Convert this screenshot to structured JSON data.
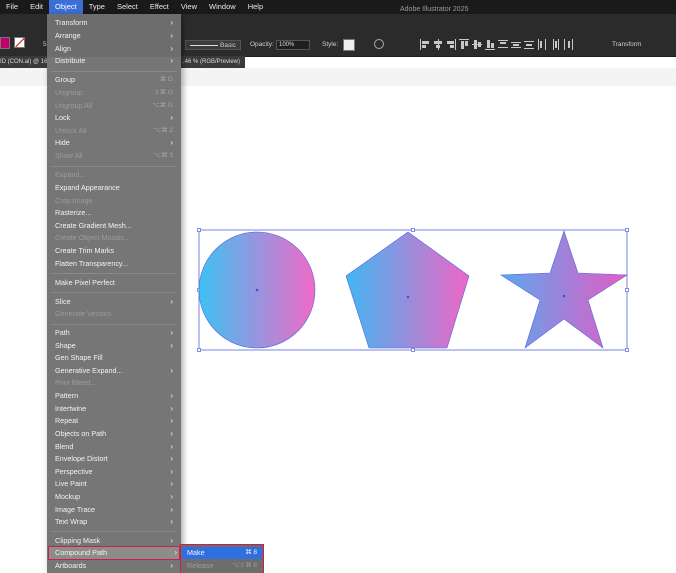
{
  "menubar": {
    "items": [
      "File",
      "Edit",
      "Object",
      "Type",
      "Select",
      "Effect",
      "View",
      "Window",
      "Help"
    ],
    "active": "Object"
  },
  "app_title": "Adobe Illustrator 2025",
  "controlbar": {
    "stroke_preset": "Basic",
    "opacity_label": "Opacity:",
    "opacity_value": "100%",
    "style_label": "Style:",
    "transform_label": "Transform",
    "stroke_weight_fragment": "5"
  },
  "document_tab": {
    "left_fragment": "ID (CON.ai) @ 16",
    "right_fragment": ".46 % (RGB/Preview)"
  },
  "object_menu": {
    "transform": "Transform",
    "arrange": "Arrange",
    "align": "Align",
    "distribute": "Distribute",
    "group": "Group",
    "group_sc": "⌘ G",
    "ungroup": "Ungroup",
    "ungroup_sc": "⇧⌘ G",
    "ungroup_all": "Ungroup All",
    "ungroup_all_sc": "⌥⌘ G",
    "lock": "Lock",
    "unlock_all": "Unlock All",
    "unlock_all_sc": "⌥⌘ 2",
    "hide": "Hide",
    "show_all": "Show All",
    "show_all_sc": "⌥⌘ 3",
    "expand": "Expand...",
    "expand_appearance": "Expand Appearance",
    "crop_image": "Crop Image",
    "rasterize": "Rasterize...",
    "create_gradient_mesh": "Create Gradient Mesh...",
    "create_object_mosaic": "Create Object Mosaic...",
    "create_trim_marks": "Create Trim Marks",
    "flatten_transparency": "Flatten Transparency...",
    "make_pixel_perfect": "Make Pixel Perfect",
    "slice": "Slice",
    "generate_vectors": "Generate Vectors",
    "path": "Path",
    "shape": "Shape",
    "gen_shape_fill": "Gen Shape Fill",
    "generative_expand": "Generative Expand...",
    "print_bleed": "Print Bleed...",
    "pattern": "Pattern",
    "intertwine": "Intertwine",
    "repeat": "Repeat",
    "objects_on_path": "Objects on Path",
    "blend": "Blend",
    "envelope_distort": "Envelope Distort",
    "perspective": "Perspective",
    "live_paint": "Live Paint",
    "mockup": "Mockup",
    "image_trace": "Image Trace",
    "text_wrap": "Text Wrap",
    "clipping_mask": "Clipping Mask",
    "compound_path": "Compound Path",
    "artboards": "Artboards"
  },
  "compound_submenu": {
    "make": "Make",
    "make_sc": "⌘ 8",
    "release": "Release",
    "release_sc": "⌥⇧⌘ 8"
  },
  "colors": {
    "gradient_start": "#3ec1f3",
    "gradient_end": "#f06ac8",
    "selection": "#5566dd",
    "highlight_outline": "#d01c4a",
    "submenu_highlight": "#2f6fe0"
  }
}
